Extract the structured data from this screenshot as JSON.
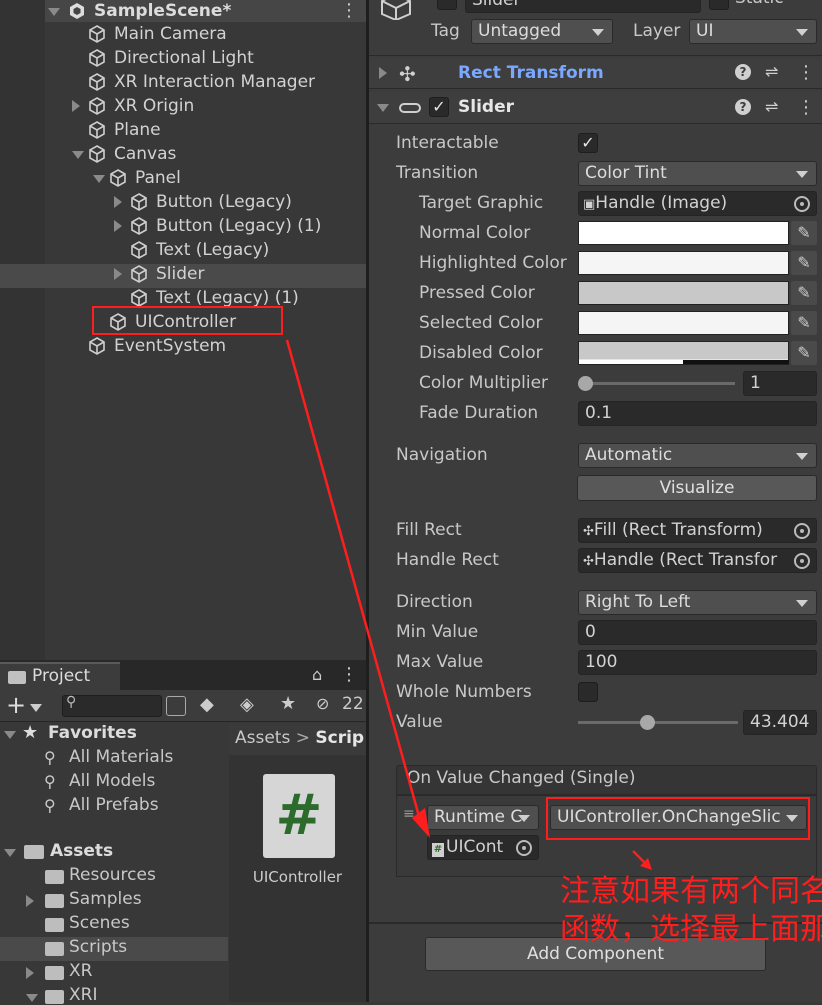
{
  "hierarchy": {
    "scene_name": "SampleScene*",
    "items": [
      {
        "label": "Main Camera"
      },
      {
        "label": "Directional Light"
      },
      {
        "label": "XR Interaction Manager"
      },
      {
        "label": "XR Origin"
      },
      {
        "label": "Plane"
      },
      {
        "label": "Canvas"
      },
      {
        "label": "Panel"
      },
      {
        "label": "Button (Legacy)"
      },
      {
        "label": "Button (Legacy) (1)"
      },
      {
        "label": "Text (Legacy)"
      },
      {
        "label": "Slider"
      },
      {
        "label": "Text (Legacy) (1)"
      },
      {
        "label": "UIController"
      },
      {
        "label": "EventSystem"
      }
    ]
  },
  "project": {
    "tab_label": "Project",
    "search_count": "22",
    "favorites_label": "Favorites",
    "favorites": [
      {
        "label": "All Materials"
      },
      {
        "label": "All Models"
      },
      {
        "label": "All Prefabs"
      }
    ],
    "assets_label": "Assets",
    "folders": [
      {
        "label": "Resources"
      },
      {
        "label": "Samples"
      },
      {
        "label": "Scenes"
      },
      {
        "label": "Scripts"
      },
      {
        "label": "XR"
      },
      {
        "label": "XRI"
      }
    ],
    "breadcrumb": {
      "root": "Assets",
      "sep": ">",
      "current": "Scrip"
    },
    "asset_icon_glyph": "#",
    "asset_name": "UIController"
  },
  "inspector": {
    "top_name": "Slider",
    "static_label": "Static",
    "tag_label": "Tag",
    "tag_value": "Untagged",
    "layer_label": "Layer",
    "layer_value": "UI",
    "rect_transform_title": "Rect Transform",
    "slider_title": "Slider",
    "interactable_label": "Interactable",
    "transition_label": "Transition",
    "transition_value": "Color Tint",
    "target_graphic_label": "Target Graphic",
    "target_graphic_value": "Handle (Image)",
    "normal_color_label": "Normal Color",
    "highlighted_color_label": "Highlighted Color",
    "pressed_color_label": "Pressed Color",
    "selected_color_label": "Selected Color",
    "disabled_color_label": "Disabled Color",
    "color_multiplier_label": "Color Multiplier",
    "color_multiplier_value": "1",
    "fade_duration_label": "Fade Duration",
    "fade_duration_value": "0.1",
    "navigation_label": "Navigation",
    "navigation_value": "Automatic",
    "visualize_label": "Visualize",
    "fill_rect_label": "Fill Rect",
    "fill_rect_value": "Fill (Rect Transform)",
    "handle_rect_label": "Handle Rect",
    "handle_rect_value": "Handle (Rect Transfor",
    "direction_label": "Direction",
    "direction_value": "Right To Left",
    "min_value_label": "Min Value",
    "min_value": "0",
    "max_value_label": "Max Value",
    "max_value": "100",
    "whole_numbers_label": "Whole Numbers",
    "value_label": "Value",
    "value": "43.404",
    "event_title": "On Value Changed (Single)",
    "runtime_value": "Runtime C",
    "function_value": "UIController.OnChangeSlic",
    "object_value": "UICont",
    "add_component_label": "Add Component"
  },
  "annotation": {
    "line1": "注意如果有两个同名",
    "line2": "函数，选择最上面那"
  },
  "colors": {
    "annotation_red": "#ff1e1e",
    "link_blue": "#7aa7ff"
  }
}
